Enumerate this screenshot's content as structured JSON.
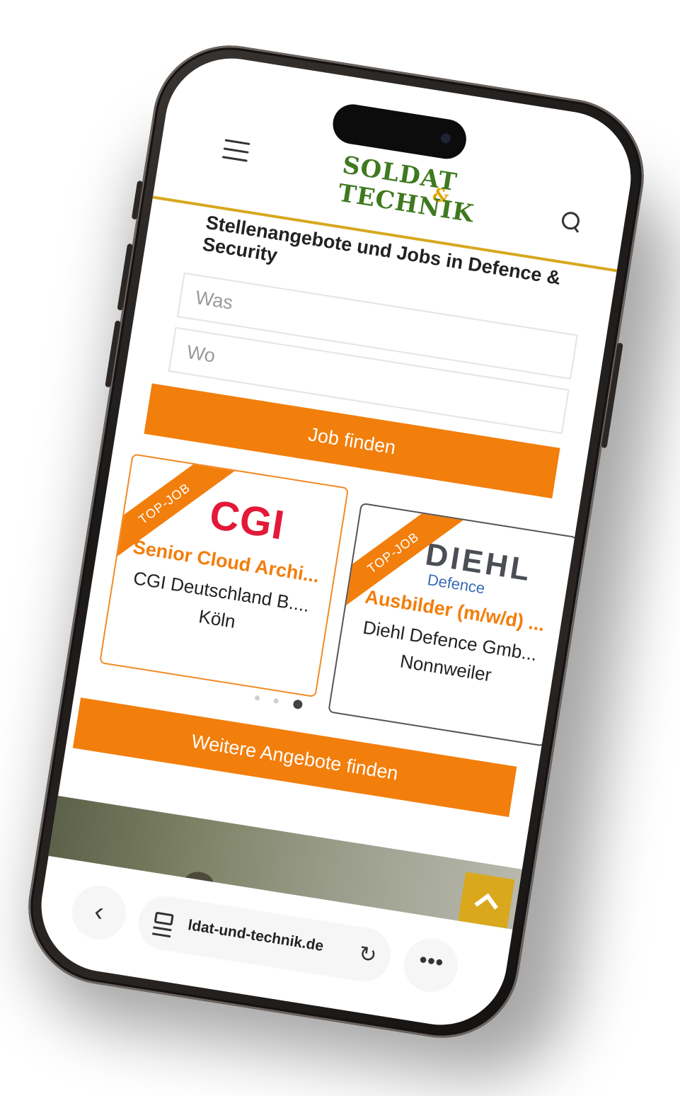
{
  "site": {
    "logo_line1": "SOLDAT",
    "logo_amp": "&",
    "logo_line2": "TECHNIK",
    "accent_color": "#f27e0c",
    "header_rule_color": "#d7a81e"
  },
  "header": {
    "menu_icon": "hamburger-menu-icon",
    "search_icon": "search-icon"
  },
  "main": {
    "title": "Stellenangebote und Jobs in Defence & Security",
    "what_placeholder": "Was",
    "where_placeholder": "Wo",
    "find_button": "Job finden",
    "more_button": "Weitere Angebote finden"
  },
  "jobs": [
    {
      "badge": "TOP-JOB",
      "company_logo": "CGI",
      "title": "Senior Cloud Archi...",
      "company": "CGI Deutschland B....",
      "location": "Köln"
    },
    {
      "badge": "TOP-JOB",
      "company_logo": "DIEHL",
      "company_logo_sub": "Defence",
      "title": "Ausbilder (m/w/d) ...",
      "company": "Diehl Defence Gmb...",
      "location": "Nonnweiler"
    }
  ],
  "carousel": {
    "dot_count": 3,
    "active_index": 2
  },
  "browser": {
    "back_icon": "‹",
    "url": "ldat-und-technik.de",
    "reload_icon": "↻",
    "more_icon": "•••"
  }
}
